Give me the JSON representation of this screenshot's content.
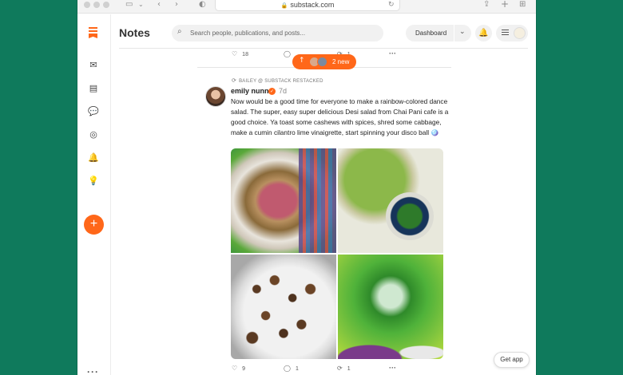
{
  "browser": {
    "url": "substack.com"
  },
  "header": {
    "title": "Notes",
    "search_placeholder": "Search people, publications, and posts...",
    "dashboard_label": "Dashboard"
  },
  "previous_post": {
    "likes": "18",
    "comments": "",
    "restacks": "1"
  },
  "new_notes": {
    "label": "2 new"
  },
  "post": {
    "restack_line": "BAILEY @ SUBSTACK RESTACKED",
    "author": "emily nunn",
    "time": "7d",
    "text": "Now would be a good time for everyone to make a rainbow-colored dance salad. The super, easy super delicious Desi salad from Chai Pani cafe is a good choice. Ya toast some cashews with spices, shred some cabbage, make a cumin cilantro lime vinaigrette, start spinning your disco ball 🪩",
    "likes": "9",
    "comments": "1",
    "restacks": "1"
  },
  "get_app_label": "Get app",
  "colors": {
    "accent": "#ff6719",
    "background": "#0f7a5c"
  }
}
